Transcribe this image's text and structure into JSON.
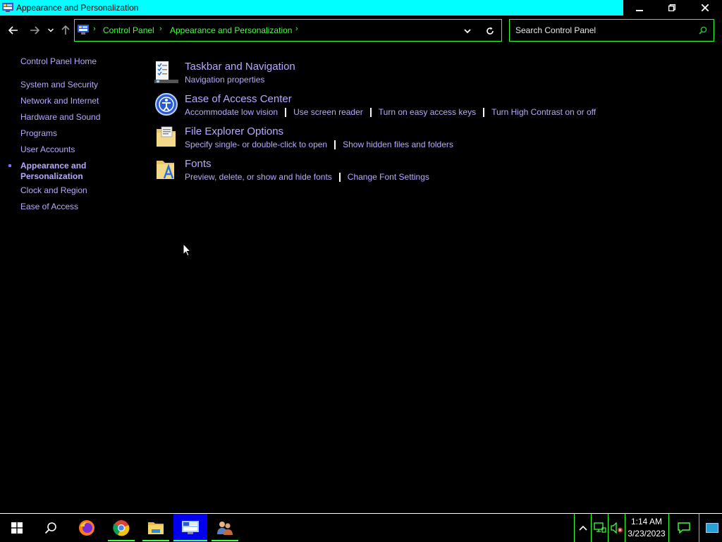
{
  "window": {
    "title": "Appearance and Personalization",
    "controls": {
      "minimize": "minimize",
      "restore": "restore",
      "close": "close"
    }
  },
  "address": {
    "breadcrumbs": [
      "Control Panel",
      "Appearance and Personalization"
    ],
    "search_placeholder": "Search Control Panel"
  },
  "sidebar": {
    "items": [
      "Control Panel Home",
      "System and Security",
      "Network and Internet",
      "Hardware and Sound",
      "Programs",
      "User Accounts",
      "Appearance and Personalization",
      "Clock and Region",
      "Ease of Access"
    ],
    "current_index": 6
  },
  "categories": [
    {
      "title": "Taskbar and Navigation",
      "icon": "taskbar-icon",
      "links": [
        "Navigation properties"
      ]
    },
    {
      "title": "Ease of Access Center",
      "icon": "ease-of-access-icon",
      "links": [
        "Accommodate low vision",
        "Use screen reader",
        "Turn on easy access keys",
        "Turn High Contrast on or off"
      ]
    },
    {
      "title": "File Explorer Options",
      "icon": "folder-options-icon",
      "links": [
        "Specify single- or double-click to open",
        "Show hidden files and folders"
      ]
    },
    {
      "title": "Fonts",
      "icon": "fonts-folder-icon",
      "links": [
        "Preview, delete, or show and hide fonts",
        "Change Font Settings"
      ]
    }
  ],
  "taskbar": {
    "apps": [
      "start-icon",
      "search-icon",
      "firefox-icon",
      "chrome-icon",
      "file-explorer-icon",
      "control-panel-icon",
      "users-icon"
    ],
    "clock_time": "1:14 AM",
    "clock_date": "3/23/2023"
  },
  "colors": {
    "title_bar": "#00ffff",
    "link": "#b9a9ff",
    "breadcrumb": "#3fff3f",
    "border": "#2fff2f",
    "background": "#000000"
  }
}
